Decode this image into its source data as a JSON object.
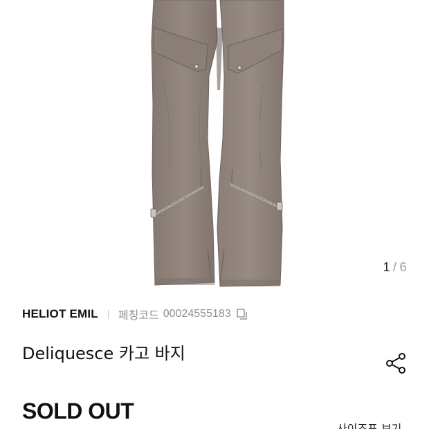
{
  "gallery": {
    "current": "1",
    "separator": "/",
    "total": "6"
  },
  "product": {
    "brand": "HELIOT EMIL",
    "code_label": "페칭코드",
    "code_value": "00024555183",
    "name": "Deliquesce 카고 바지",
    "status": "SOLD OUT",
    "pants_color": "#8f8278"
  },
  "footer": {
    "partial_right_text": "사이즈표 보기"
  },
  "icons": {
    "copy": "copy-icon",
    "share": "share-icon"
  }
}
